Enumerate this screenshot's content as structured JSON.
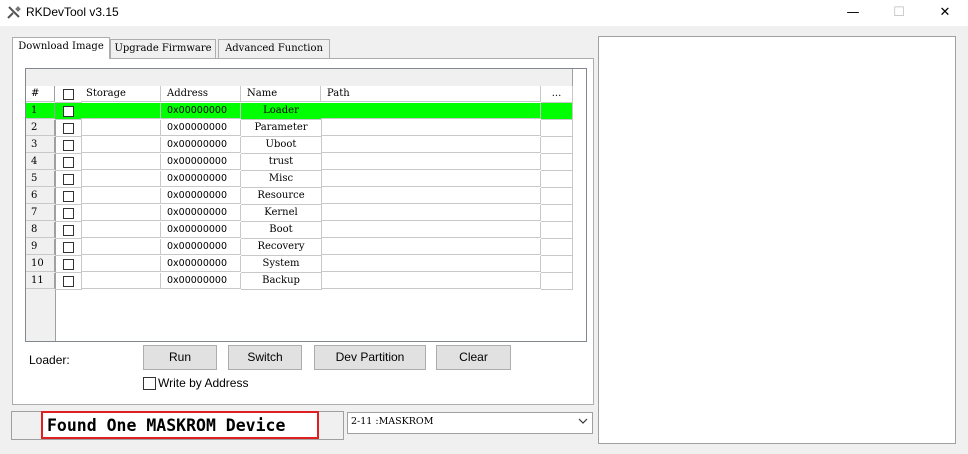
{
  "window": {
    "title": "RKDevTool v3.15",
    "minimize_glyph": "—",
    "maximize_glyph": "☐",
    "close_glyph": "✕"
  },
  "tabs": [
    {
      "label": "Download Image",
      "active": true
    },
    {
      "label": "Upgrade Firmware",
      "active": false
    },
    {
      "label": "Advanced Function",
      "active": false
    }
  ],
  "table": {
    "columns": [
      "#",
      "",
      "Storage",
      "Address",
      "Name",
      "Path",
      "..."
    ],
    "rows": [
      {
        "num": "1",
        "storage": "",
        "address": "0x00000000",
        "name": "Loader",
        "path": "",
        "selected": true
      },
      {
        "num": "2",
        "storage": "",
        "address": "0x00000000",
        "name": "Parameter",
        "path": "",
        "selected": false
      },
      {
        "num": "3",
        "storage": "",
        "address": "0x00000000",
        "name": "Uboot",
        "path": "",
        "selected": false
      },
      {
        "num": "4",
        "storage": "",
        "address": "0x00000000",
        "name": "trust",
        "path": "",
        "selected": false
      },
      {
        "num": "5",
        "storage": "",
        "address": "0x00000000",
        "name": "Misc",
        "path": "",
        "selected": false
      },
      {
        "num": "6",
        "storage": "",
        "address": "0x00000000",
        "name": "Resource",
        "path": "",
        "selected": false
      },
      {
        "num": "7",
        "storage": "",
        "address": "0x00000000",
        "name": "Kernel",
        "path": "",
        "selected": false
      },
      {
        "num": "8",
        "storage": "",
        "address": "0x00000000",
        "name": "Boot",
        "path": "",
        "selected": false
      },
      {
        "num": "9",
        "storage": "",
        "address": "0x00000000",
        "name": "Recovery",
        "path": "",
        "selected": false
      },
      {
        "num": "10",
        "storage": "",
        "address": "0x00000000",
        "name": "System",
        "path": "",
        "selected": false
      },
      {
        "num": "11",
        "storage": "",
        "address": "0x00000000",
        "name": "Backup",
        "path": "",
        "selected": false
      }
    ]
  },
  "controls": {
    "loader_label": "Loader:",
    "run_label": "Run",
    "switch_label": "Switch",
    "dev_partition_label": "Dev Partition",
    "clear_label": "Clear",
    "write_by_address_label": "Write by Address"
  },
  "status": {
    "message": "Found One MASKROM Device",
    "device_selected": "2-11 :MASKROM"
  },
  "colors": {
    "selected_row": "#00ff00",
    "highlight_border": "#e02020"
  }
}
